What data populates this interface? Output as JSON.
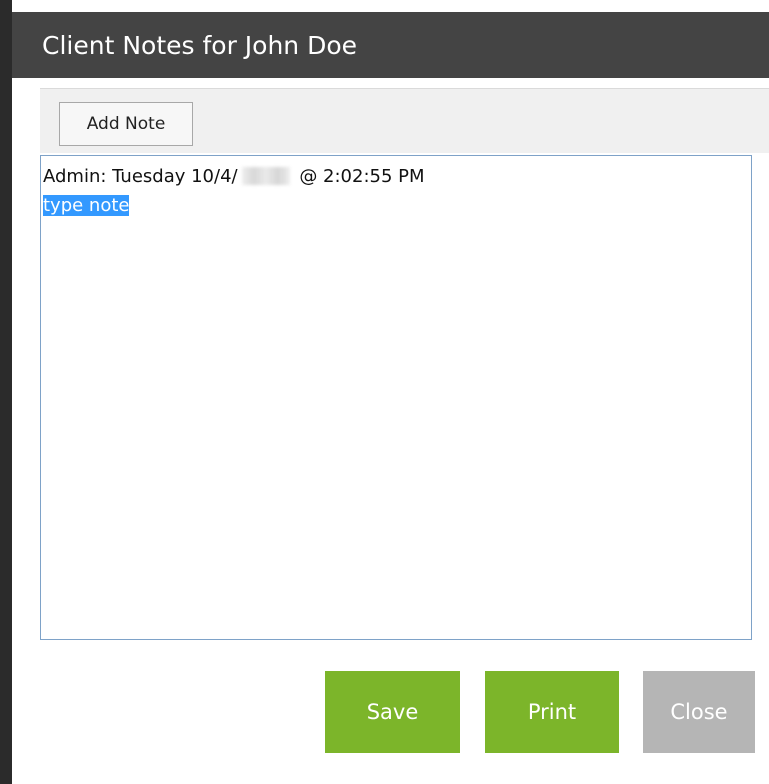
{
  "dialog": {
    "title": "Client Notes for John Doe"
  },
  "toolbar": {
    "add_note_label": "Add Note"
  },
  "notes": {
    "header_prefix": "Admin: Tuesday 10/4/",
    "header_year_redacted": "2016",
    "header_suffix": " @ 2:02:55 PM",
    "selected_text": "type note"
  },
  "actions": {
    "save_label": "Save",
    "print_label": "Print",
    "close_label": "Close"
  },
  "colors": {
    "titlebar": "#444444",
    "primary_button": "#7cb52a",
    "disabled_button": "#b5b5b5",
    "selection": "#3399ff"
  }
}
